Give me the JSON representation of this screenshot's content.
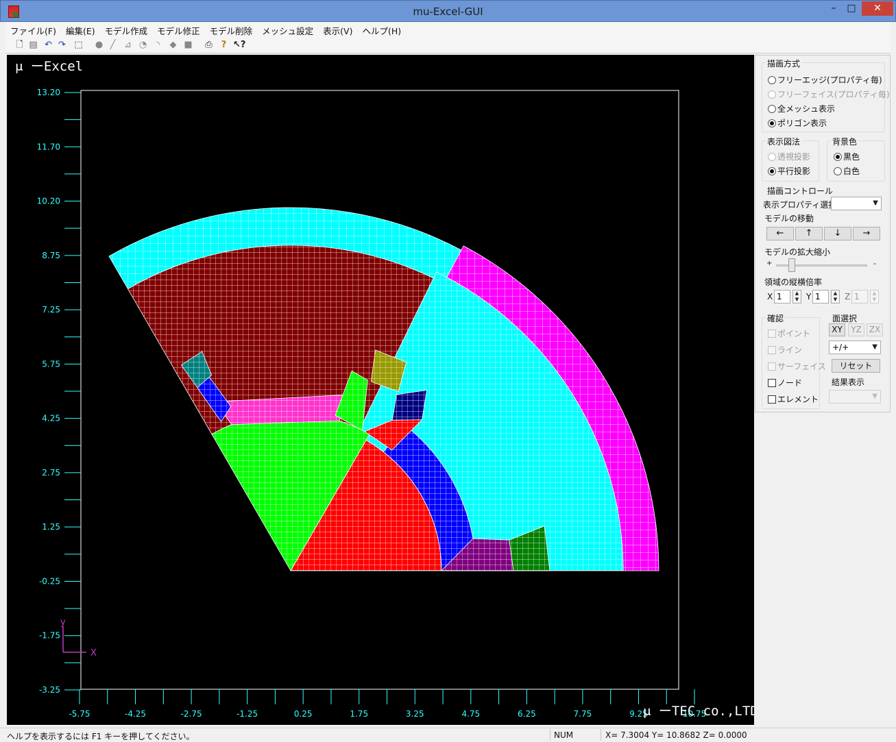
{
  "window": {
    "title": "mu-Excel-GUI",
    "minimize": "–",
    "maximize": "□",
    "close": "✕"
  },
  "menu": [
    "ファイル(F)",
    "編集(E)",
    "モデル作成",
    "モデル修正",
    "モデル削除",
    "メッシュ設定",
    "表示(V)",
    "ヘルプ(H)"
  ],
  "toolbar_icons": [
    "new-file-icon",
    "save-icon",
    "undo-icon",
    "redo-icon",
    "select-rect-icon",
    "point-icon",
    "line-icon",
    "polyline-icon",
    "arc-icon",
    "arc2-icon",
    "region-icon",
    "face-icon",
    "print-icon",
    "help-icon",
    "context-help-icon"
  ],
  "viewport": {
    "logo": "μ ーExcel",
    "company": "μ ーTEC co.,LTD",
    "background": "#000000",
    "axis_color": "#3ff",
    "y_ticks": [
      "13.20",
      "11.70",
      "10.20",
      "8.75",
      "7.25",
      "5.75",
      "4.25",
      "2.75",
      "1.25",
      "-0.25",
      "-1.75",
      "-3.25"
    ],
    "x_ticks": [
      "-5.75",
      "-4.25",
      "-2.75",
      "-1.25",
      "0.25",
      "1.75",
      "3.25",
      "4.75",
      "6.25",
      "7.75",
      "9.25",
      "10.75"
    ],
    "triad": {
      "x": "X",
      "y": "y"
    }
  },
  "panel": {
    "draw_mode": {
      "title": "描画方式",
      "options": [
        {
          "label": "フリーエッジ(プロパティ毎)",
          "selected": false,
          "disabled": false
        },
        {
          "label": "フリーフェイス(プロパティ毎)",
          "selected": false,
          "disabled": true
        },
        {
          "label": "全メッシュ表示",
          "selected": false,
          "disabled": false
        },
        {
          "label": "ポリゴン表示",
          "selected": true,
          "disabled": false
        }
      ]
    },
    "projection": {
      "title": "表示図法",
      "options": [
        {
          "label": "透視投影",
          "selected": false,
          "disabled": true
        },
        {
          "label": "平行投影",
          "selected": true,
          "disabled": false
        }
      ]
    },
    "background": {
      "title": "背景色",
      "options": [
        {
          "label": "黒色",
          "selected": true
        },
        {
          "label": "白色",
          "selected": false
        }
      ]
    },
    "control": {
      "title": "描画コントロール",
      "property_label": "表示プロパティ選択",
      "property_value": "",
      "move_label": "モデルの移動",
      "move_buttons": [
        "←",
        "↑",
        "↓",
        "→"
      ],
      "zoom_label": "モデルの拡大縮小",
      "zoom_plus": "+",
      "zoom_minus": "-",
      "zoom_level": 0.15,
      "scale_label": "領域の縦横倍率",
      "x_label": "X",
      "x_value": "1",
      "y_label": "Y",
      "y_value": "1",
      "z_label": "Z",
      "z_value": "1"
    },
    "confirm": {
      "title": "確認",
      "items": [
        {
          "label": "ポイント",
          "checked": false,
          "disabled": true
        },
        {
          "label": "ライン",
          "checked": false,
          "disabled": true
        },
        {
          "label": "サーフェイス",
          "checked": false,
          "disabled": true
        },
        {
          "label": "ノード",
          "checked": false,
          "disabled": false
        },
        {
          "label": "エレメント",
          "checked": false,
          "disabled": false
        }
      ]
    },
    "plane": {
      "title": "面選択",
      "buttons": [
        {
          "label": "XY",
          "disabled": false
        },
        {
          "label": "YZ",
          "disabled": true
        },
        {
          "label": "ZX",
          "disabled": true
        }
      ],
      "direction": "+/+",
      "reset": "リセット",
      "result_label": "結果表示",
      "result_value": ""
    }
  },
  "status": {
    "help": "ヘルプを表示するには F1 キーを押してください。",
    "num": "NUM",
    "coords": "X= 7.3004 Y= 10.8682 Z= 0.0000"
  }
}
